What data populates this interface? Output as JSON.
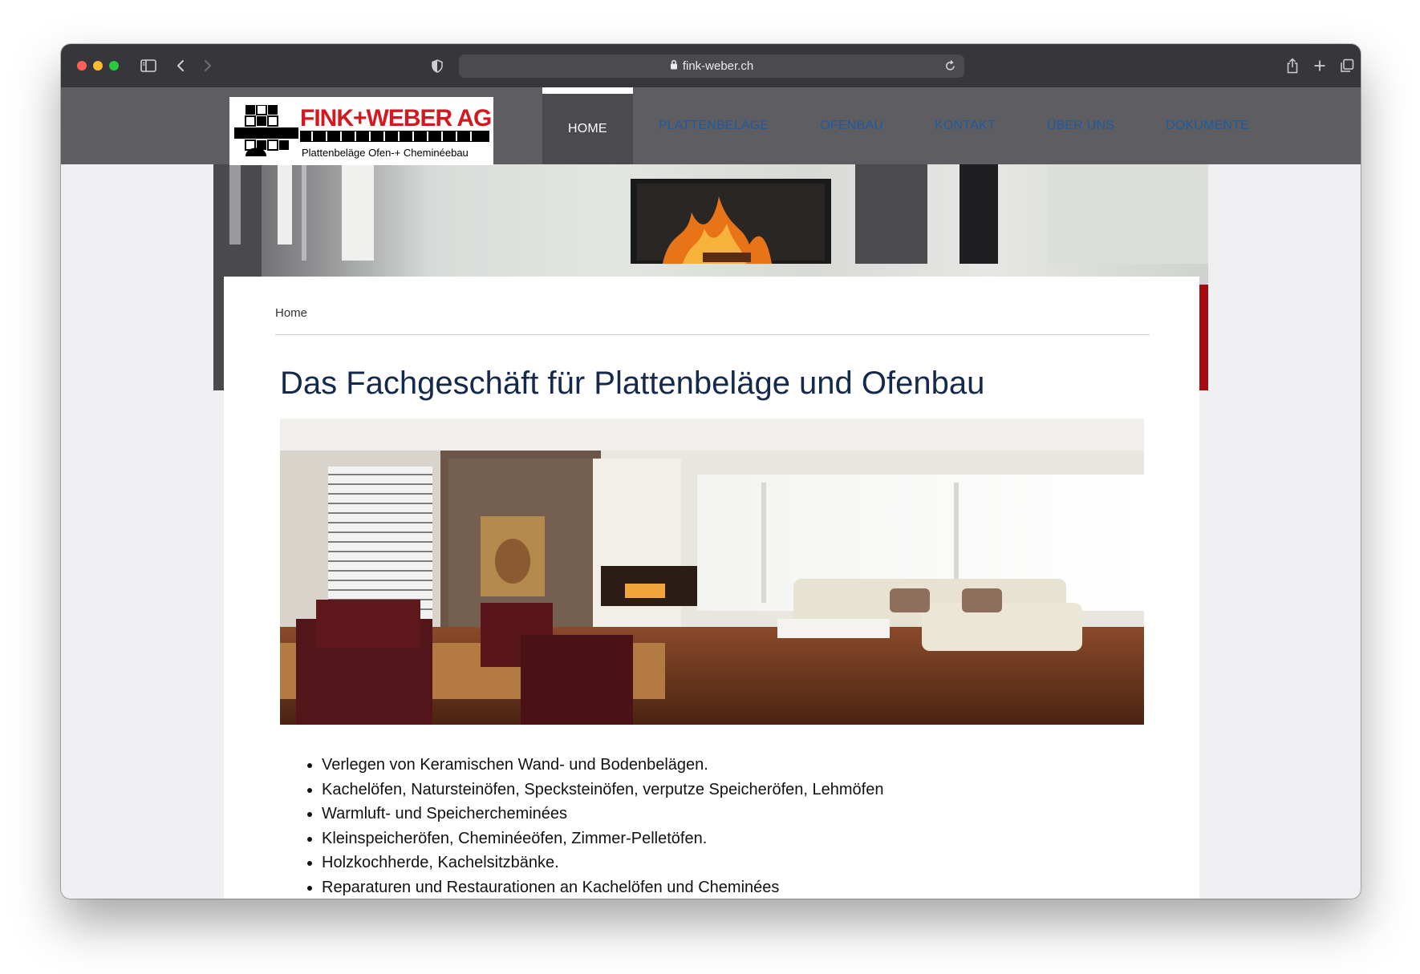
{
  "browser": {
    "url": "fink-weber.ch"
  },
  "logo": {
    "name": "FINK+WEBER AG",
    "tagline": "Plattenbeläge  Ofen-+ Cheminéebau"
  },
  "nav": {
    "items": [
      {
        "label": "HOME",
        "active": true
      },
      {
        "label": "PLATTENBELÄGE",
        "active": false
      },
      {
        "label": "OFENBAU",
        "active": false
      },
      {
        "label": "KONTAKT",
        "active": false
      },
      {
        "label": "ÜBER UNS",
        "active": false
      },
      {
        "label": "DOKUMENTE",
        "active": false
      }
    ]
  },
  "breadcrumb": "Home",
  "page_title": "Das Fachgeschäft für Plattenbeläge und Ofenbau",
  "features": [
    "Verlegen von Keramischen Wand- und Bodenbelägen.",
    "Kachelöfen, Natursteinöfen, Specksteinöfen, verputze Speicheröfen, Lehmöfen",
    "Warmluft- und Speichercheminées",
    "Kleinspeicheröfen, Cheminéeöfen, Zimmer-Pelletöfen.",
    "Holzkochherde, Kachelsitzbänke.",
    "Reparaturen und Restaurationen an Kachelöfen und Cheminées"
  ],
  "colors": {
    "brand_red": "#d4181f",
    "nav_link": "#1f5a9e",
    "header_bg": "#5d5d62",
    "title": "#15294d"
  }
}
